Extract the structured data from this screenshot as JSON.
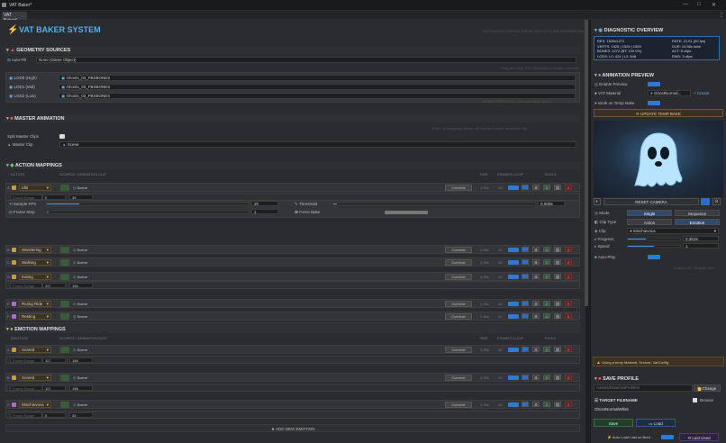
{
  "window": {
    "title": "VAT Baker*",
    "tab": "VAT Baker*",
    "minimize": "—",
    "maximize": "□",
    "close": "✕"
  },
  "header": {
    "title": "VAT BAKER SYSTEM",
    "subtitle": "AUTOMATED VERTEX ANIMATION TEXTURE GENERATION"
  },
  "geometry": {
    "title": "GEOMETRY SOURCES",
    "auto_fill": "Auto-Fill",
    "auto_fill_value": "None (Game Object)",
    "hint": "Drag and drop FBX hierarchy or assign manually",
    "lods": [
      {
        "label": "LOD0 (High)",
        "value": "Ghosts_03_FBXBONES"
      },
      {
        "label": "LOD1 (Mid)",
        "value": "Ghosts_03_FBXBONES"
      },
      {
        "label": "LOD2 (Low)",
        "value": "Ghosts_03_FBXBONES"
      }
    ],
    "footer": "BONES DETECTED: Skinned Mesh Active"
  },
  "master": {
    "title": "MASTER ANIMATION",
    "hint": "If set, all mappings above will use the master animation clip",
    "split": "Split Master Clips",
    "clip_label": "Master Clip",
    "clip_value": "Scene"
  },
  "actions": {
    "title": "ACTION MAPPINGS",
    "col_action": "ACTION",
    "col_source": "SOURCE / ANIMATION CLIP",
    "col_time": "TIME",
    "col_frames": "FRAMES",
    "col_loop": "LOOP",
    "col_tools": "TOOLS",
    "add": "ADD NEW ACTION",
    "override": "Override",
    "sample_fps": "Sample FPS",
    "sample_fps_val": "20",
    "threshold": "Threshold",
    "threshold_val": "0.0005",
    "frame_step": "Frame Step",
    "frame_step_val": "1",
    "force_bake": "Force Bake",
    "frame_range": "Frame Range",
    "rows": [
      {
        "key": "A",
        "name": "Idle",
        "clip": "Scene",
        "time": "1.95s",
        "frames": "40",
        "range": [
          "0",
          "39"
        ]
      },
      {
        "key": "B",
        "name": "Wandering",
        "clip": "Scene",
        "time": "1.95s",
        "frames": "40"
      },
      {
        "key": "C",
        "name": "Walking",
        "clip": "Scene",
        "time": "1.95s",
        "frames": "40"
      },
      {
        "key": "D",
        "name": "Eating",
        "clip": "Scene",
        "time": "1.95s",
        "frames": "40",
        "range": [
          "117",
          "156"
        ]
      },
      {
        "key": "E",
        "name": "Riding Ride",
        "clip": "Scene",
        "time": "1.95s",
        "frames": "40"
      },
      {
        "key": "F",
        "name": "Resting",
        "clip": "Scene",
        "time": "1.95s",
        "frames": "40"
      }
    ]
  },
  "emotions": {
    "title": "EMOTION MAPPINGS",
    "col_emotion": "EMOTION",
    "col_source": "SOURCE / ANIMATION CLIP",
    "col_time": "TIME",
    "col_frames": "FRAMES",
    "col_loop": "LOOP",
    "col_tools": "TOOLS",
    "add": "ADD NEW EMOTION",
    "override": "Override",
    "frame_range": "Frame Range",
    "rows": [
      {
        "key": "A",
        "name": "Scared",
        "clip": "Scene",
        "time": "1.95s",
        "frames": "40",
        "range": [
          "117",
          "156"
        ]
      },
      {
        "key": "B",
        "name": "Scared",
        "clip": "Scene",
        "time": "1.95s",
        "frames": "40",
        "range": [
          "117",
          "156"
        ]
      },
      {
        "key": "C",
        "name": "Mischievous",
        "clip": "Scene",
        "time": "1.95s",
        "frames": "40",
        "range": [
          "0",
          "39"
        ]
      }
    ]
  },
  "diagnostic": {
    "title": "DIAGNOSTIC OVERVIEW",
    "left": [
      "RES: 1525x1272",
      "VERTS: 1525 | 1525 | 1525",
      "BONES: 1272 (BT: 100.0%)",
      "LODS: L0: 424 | L2: 848"
    ],
    "right": [
      "RATE: 21.01 (20 fps)",
      "DUR: 14.56s total",
      "ACT: 8 clips",
      "EMO: 3 clips"
    ]
  },
  "preview": {
    "title": "ANIMATION PREVIEW",
    "enable": "Enable Preview",
    "vat_material": "VAT Material",
    "vat_value": "GhostNormal...",
    "create": "Create",
    "work_on_temp": "Work on Temp Bake",
    "update_btn": "UPDATE TEMP BAKE",
    "preview_cam": "Preview Cam",
    "reset_camera": "RESET CAMERA",
    "mode": "Mode",
    "single": "Single",
    "sequence": "Sequence",
    "clip_type": "Clip Type",
    "action": "Action",
    "emotion": "Emotion",
    "clip": "Clip",
    "clip_value": "Mischievous",
    "progress": "Progress",
    "progress_val": "0.3518",
    "speed": "Speed",
    "speed_val": "1",
    "autoplay": "Auto-Play",
    "frames": "Frames 00 / Sustain 140s"
  },
  "notice": "Using a temp Material, Texture, VatConfig",
  "save": {
    "title": "SAVE PROFILE",
    "path": "Assets/Data/VatProfiles/",
    "change": "Change",
    "target": "TARGET FILENAME",
    "browse": "Browse",
    "filename": "GhostNormalWhite",
    "save_btn": "Save",
    "load_btn": "Load",
    "auto_load": "Auto Load Last on Boot",
    "last_used": "Last Used"
  }
}
